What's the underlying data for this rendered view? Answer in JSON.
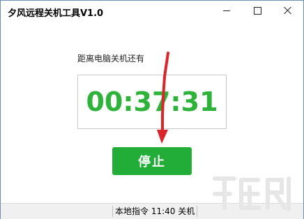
{
  "window": {
    "title": "夕风远程关机工具V1.0"
  },
  "main": {
    "caption": "距离电脑关机还有",
    "countdown": "00:37:31",
    "stop_label": "停止"
  },
  "statusbar": {
    "text": "本地指令 11:40 关机"
  },
  "colors": {
    "accent_green": "#22ac38",
    "timer_green": "#2eb23a",
    "annotation_red": "#d9262b"
  },
  "icons": {
    "minimize": "minimize-icon",
    "maximize": "maximize-icon",
    "close": "close-icon"
  }
}
